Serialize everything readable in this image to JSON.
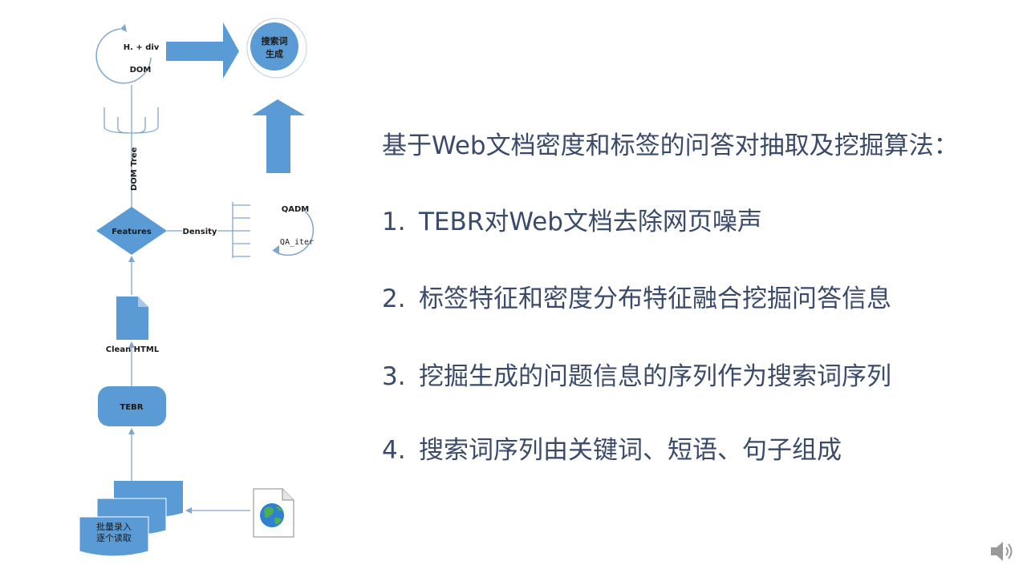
{
  "diagram": {
    "loop_top": {
      "line1": "H. + div",
      "line2": "DOM"
    },
    "target_circle": {
      "line1": "搜索词",
      "line2": "生成"
    },
    "dom_tree_label": "DOM Tree",
    "features_label": "Features",
    "density_label": "Density",
    "loop_right": {
      "line1": "QADM",
      "line2": "QA_iter"
    },
    "clean_html_label": "Clean HTML",
    "tebr_label": "TEBR",
    "docs": {
      "line1": "批量录入",
      "line2": "逐个读取"
    },
    "icons": {
      "web_file": "globe-file-icon",
      "speaker": "speaker-icon"
    },
    "colors": {
      "shape_fill": "#5b9bd5",
      "line": "#7fa6d1",
      "text": "#3a4a6b"
    }
  },
  "text": {
    "heading": "基于Web文档密度和标签的问答对抽取及挖掘算法：",
    "items": [
      {
        "num": "1.",
        "text": "TEBR对Web文档去除网页噪声"
      },
      {
        "num": "2.",
        "text": "标签特征和密度分布特征融合挖掘问答信息"
      },
      {
        "num": "3.",
        "text": "挖掘生成的问题信息的序列作为搜索词序列"
      },
      {
        "num": "4.",
        "text": "搜索词序列由关键词、短语、句子组成"
      }
    ]
  }
}
